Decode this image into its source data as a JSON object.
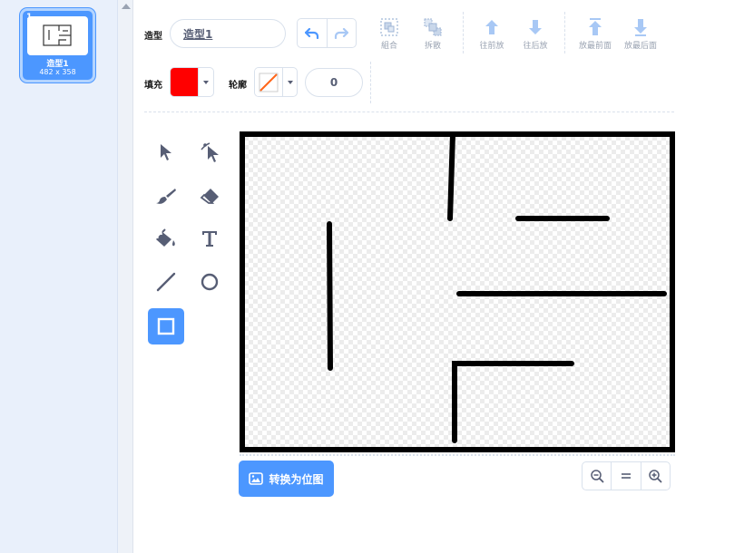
{
  "costume_list": {
    "items": [
      {
        "number": "1",
        "name": "造型1",
        "size": "482 x 358"
      }
    ]
  },
  "toolbar": {
    "costume_label": "造型",
    "costume_name": "造型1",
    "group_label": "組合",
    "ungroup_label": "拆散",
    "forward_label": "往前放",
    "backward_label": "往后放",
    "front_label": "放最前面",
    "back_label": "放最后面",
    "fill_label": "填充",
    "fill_color": "#ff0000",
    "outline_label": "轮廓",
    "outline_width": "0"
  },
  "tools": [
    {
      "name": "select",
      "icon": "select-arrow-icon"
    },
    {
      "name": "reshape",
      "icon": "reshape-icon"
    },
    {
      "name": "brush",
      "icon": "brush-icon"
    },
    {
      "name": "eraser",
      "icon": "eraser-icon"
    },
    {
      "name": "fill",
      "icon": "fill-bucket-icon"
    },
    {
      "name": "text",
      "icon": "text-icon"
    },
    {
      "name": "line",
      "icon": "line-icon"
    },
    {
      "name": "circle",
      "icon": "circle-icon"
    },
    {
      "name": "rectangle",
      "icon": "rectangle-icon",
      "selected": true
    }
  ],
  "footer": {
    "convert_label": "转换为位图"
  },
  "colors": {
    "accent": "#4c97ff",
    "panel_bg": "#e9f0fb",
    "text": "#575e75",
    "maze": "#000000"
  }
}
